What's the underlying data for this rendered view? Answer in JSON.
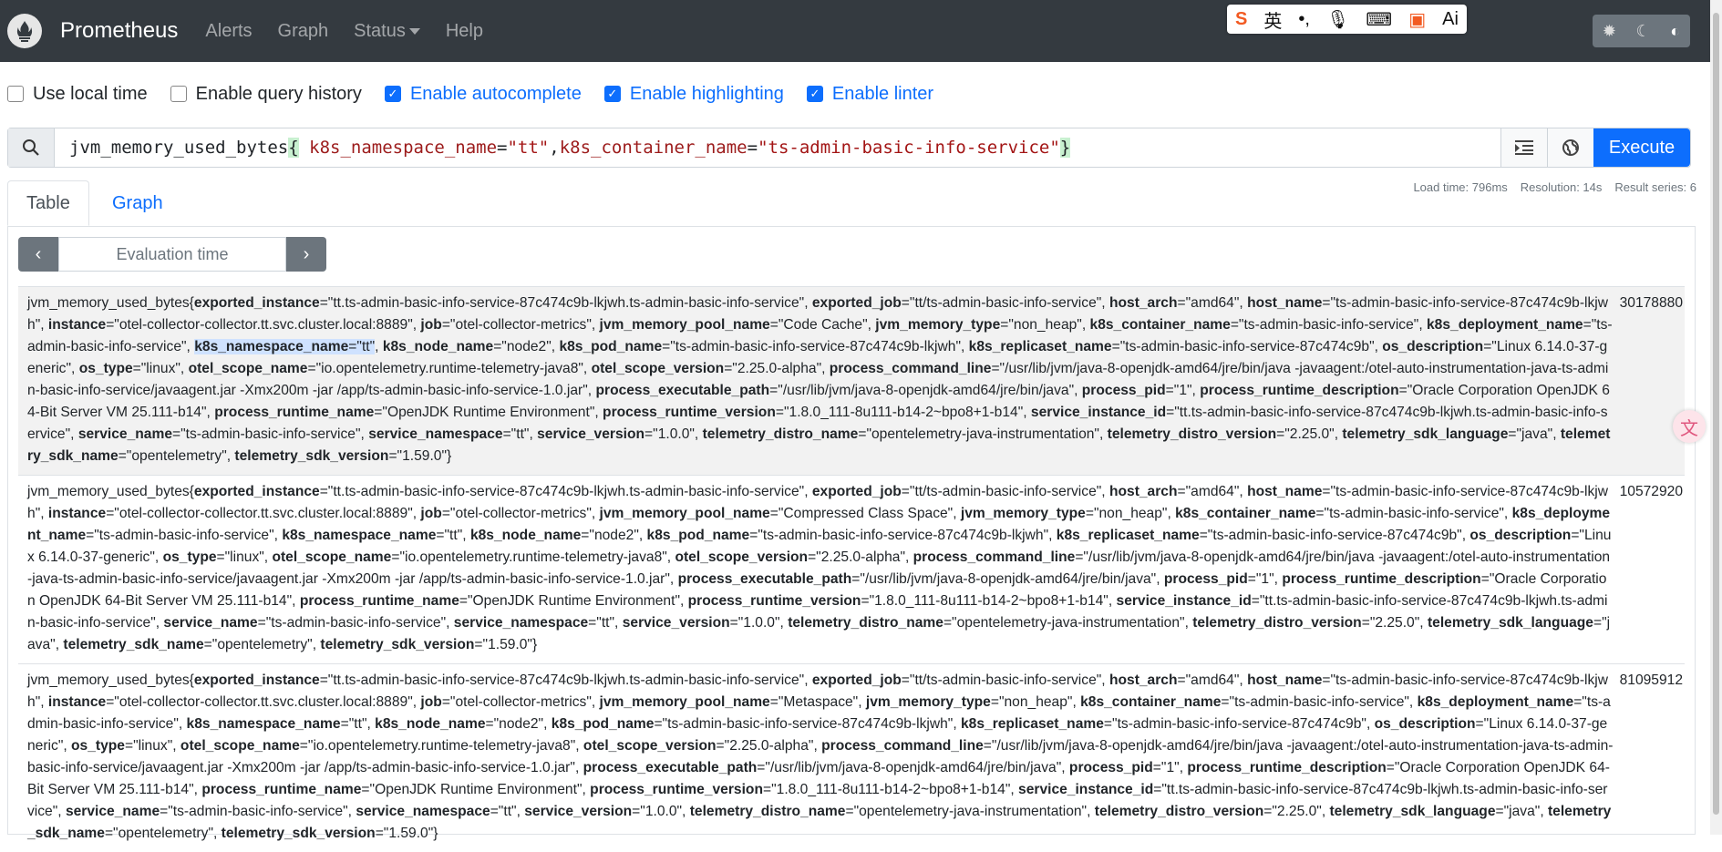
{
  "navbar": {
    "brand": "Prometheus",
    "items": [
      "Alerts",
      "Graph",
      "Status",
      "Help"
    ]
  },
  "ime_toolbar": {
    "lang_label": "英",
    "ai_label": "Ai"
  },
  "options": [
    {
      "label": "Use local time",
      "checked": false
    },
    {
      "label": "Enable query history",
      "checked": false
    },
    {
      "label": "Enable autocomplete",
      "checked": true
    },
    {
      "label": "Enable highlighting",
      "checked": true
    },
    {
      "label": "Enable linter",
      "checked": true
    }
  ],
  "query": {
    "metric": "jvm_memory_used_bytes",
    "open_brace": "{",
    "label1": "k8s_namespace_name",
    "value1": "\"tt\"",
    "label2": "k8s_container_name",
    "value2": "\"ts-admin-basic-info-service\"",
    "close_brace": "}",
    "execute_label": "Execute"
  },
  "stats": {
    "load_time": "Load time: 796ms",
    "resolution": "Resolution: 14s",
    "result_series": "Result series: 6"
  },
  "tabs": [
    "Table",
    "Graph"
  ],
  "evaluation": {
    "placeholder": "Evaluation time"
  },
  "results": [
    {
      "metric": "jvm_memory_used_bytes",
      "value": "30178880",
      "labels": [
        [
          "exported_instance",
          "tt.ts-admin-basic-info-service-87c474c9b-lkjwh.ts-admin-basic-info-service"
        ],
        [
          "exported_job",
          "tt/ts-admin-basic-info-service"
        ],
        [
          "host_arch",
          "amd64"
        ],
        [
          "host_name",
          "ts-admin-basic-info-service-87c474c9b-lkjwh"
        ],
        [
          "instance",
          "otel-collector-collector.tt.svc.cluster.local:8889"
        ],
        [
          "job",
          "otel-collector-metrics"
        ],
        [
          "jvm_memory_pool_name",
          "Code Cache"
        ],
        [
          "jvm_memory_type",
          "non_heap"
        ],
        [
          "k8s_container_name",
          "ts-admin-basic-info-service"
        ],
        [
          "k8s_deployment_name",
          "ts-admin-basic-info-service"
        ],
        [
          "k8s_namespace_name",
          "tt"
        ],
        [
          "k8s_node_name",
          "node2"
        ],
        [
          "k8s_pod_name",
          "ts-admin-basic-info-service-87c474c9b-lkjwh"
        ],
        [
          "k8s_replicaset_name",
          "ts-admin-basic-info-service-87c474c9b"
        ],
        [
          "os_description",
          "Linux 6.14.0-37-generic"
        ],
        [
          "os_type",
          "linux"
        ],
        [
          "otel_scope_name",
          "io.opentelemetry.runtime-telemetry-java8"
        ],
        [
          "otel_scope_version",
          "2.25.0-alpha"
        ],
        [
          "process_command_line",
          "/usr/lib/jvm/java-8-openjdk-amd64/jre/bin/java -javaagent:/otel-auto-instrumentation-java-ts-admin-basic-info-service/javaagent.jar -Xmx200m -jar /app/ts-admin-basic-info-service-1.0.jar"
        ],
        [
          "process_executable_path",
          "/usr/lib/jvm/java-8-openjdk-amd64/jre/bin/java"
        ],
        [
          "process_pid",
          "1"
        ],
        [
          "process_runtime_description",
          "Oracle Corporation OpenJDK 64-Bit Server VM 25.111-b14"
        ],
        [
          "process_runtime_name",
          "OpenJDK Runtime Environment"
        ],
        [
          "process_runtime_version",
          "1.8.0_111-8u111-b14-2~bpo8+1-b14"
        ],
        [
          "service_instance_id",
          "tt.ts-admin-basic-info-service-87c474c9b-lkjwh.ts-admin-basic-info-service"
        ],
        [
          "service_name",
          "ts-admin-basic-info-service"
        ],
        [
          "service_namespace",
          "tt"
        ],
        [
          "service_version",
          "1.0.0"
        ],
        [
          "telemetry_distro_name",
          "opentelemetry-java-instrumentation"
        ],
        [
          "telemetry_distro_version",
          "2.25.0"
        ],
        [
          "telemetry_sdk_language",
          "java"
        ],
        [
          "telemetry_sdk_name",
          "opentelemetry"
        ],
        [
          "telemetry_sdk_version",
          "1.59.0"
        ]
      ]
    },
    {
      "metric": "jvm_memory_used_bytes",
      "value": "10572920",
      "labels": [
        [
          "exported_instance",
          "tt.ts-admin-basic-info-service-87c474c9b-lkjwh.ts-admin-basic-info-service"
        ],
        [
          "exported_job",
          "tt/ts-admin-basic-info-service"
        ],
        [
          "host_arch",
          "amd64"
        ],
        [
          "host_name",
          "ts-admin-basic-info-service-87c474c9b-lkjwh"
        ],
        [
          "instance",
          "otel-collector-collector.tt.svc.cluster.local:8889"
        ],
        [
          "job",
          "otel-collector-metrics"
        ],
        [
          "jvm_memory_pool_name",
          "Compressed Class Space"
        ],
        [
          "jvm_memory_type",
          "non_heap"
        ],
        [
          "k8s_container_name",
          "ts-admin-basic-info-service"
        ],
        [
          "k8s_deployment_name",
          "ts-admin-basic-info-service"
        ],
        [
          "k8s_namespace_name",
          "tt"
        ],
        [
          "k8s_node_name",
          "node2"
        ],
        [
          "k8s_pod_name",
          "ts-admin-basic-info-service-87c474c9b-lkjwh"
        ],
        [
          "k8s_replicaset_name",
          "ts-admin-basic-info-service-87c474c9b"
        ],
        [
          "os_description",
          "Linux 6.14.0-37-generic"
        ],
        [
          "os_type",
          "linux"
        ],
        [
          "otel_scope_name",
          "io.opentelemetry.runtime-telemetry-java8"
        ],
        [
          "otel_scope_version",
          "2.25.0-alpha"
        ],
        [
          "process_command_line",
          "/usr/lib/jvm/java-8-openjdk-amd64/jre/bin/java -javaagent:/otel-auto-instrumentation-java-ts-admin-basic-info-service/javaagent.jar -Xmx200m -jar /app/ts-admin-basic-info-service-1.0.jar"
        ],
        [
          "process_executable_path",
          "/usr/lib/jvm/java-8-openjdk-amd64/jre/bin/java"
        ],
        [
          "process_pid",
          "1"
        ],
        [
          "process_runtime_description",
          "Oracle Corporation OpenJDK 64-Bit Server VM 25.111-b14"
        ],
        [
          "process_runtime_name",
          "OpenJDK Runtime Environment"
        ],
        [
          "process_runtime_version",
          "1.8.0_111-8u111-b14-2~bpo8+1-b14"
        ],
        [
          "service_instance_id",
          "tt.ts-admin-basic-info-service-87c474c9b-lkjwh.ts-admin-basic-info-service"
        ],
        [
          "service_name",
          "ts-admin-basic-info-service"
        ],
        [
          "service_namespace",
          "tt"
        ],
        [
          "service_version",
          "1.0.0"
        ],
        [
          "telemetry_distro_name",
          "opentelemetry-java-instrumentation"
        ],
        [
          "telemetry_distro_version",
          "2.25.0"
        ],
        [
          "telemetry_sdk_language",
          "java"
        ],
        [
          "telemetry_sdk_name",
          "opentelemetry"
        ],
        [
          "telemetry_sdk_version",
          "1.59.0"
        ]
      ]
    },
    {
      "metric": "jvm_memory_used_bytes",
      "value": "81095912",
      "labels": [
        [
          "exported_instance",
          "tt.ts-admin-basic-info-service-87c474c9b-lkjwh.ts-admin-basic-info-service"
        ],
        [
          "exported_job",
          "tt/ts-admin-basic-info-service"
        ],
        [
          "host_arch",
          "amd64"
        ],
        [
          "host_name",
          "ts-admin-basic-info-service-87c474c9b-lkjwh"
        ],
        [
          "instance",
          "otel-collector-collector.tt.svc.cluster.local:8889"
        ],
        [
          "job",
          "otel-collector-metrics"
        ],
        [
          "jvm_memory_pool_name",
          "Metaspace"
        ],
        [
          "jvm_memory_type",
          "non_heap"
        ],
        [
          "k8s_container_name",
          "ts-admin-basic-info-service"
        ],
        [
          "k8s_deployment_name",
          "ts-admin-basic-info-service"
        ],
        [
          "k8s_namespace_name",
          "tt"
        ],
        [
          "k8s_node_name",
          "node2"
        ],
        [
          "k8s_pod_name",
          "ts-admin-basic-info-service-87c474c9b-lkjwh"
        ],
        [
          "k8s_replicaset_name",
          "ts-admin-basic-info-service-87c474c9b"
        ],
        [
          "os_description",
          "Linux 6.14.0-37-generic"
        ],
        [
          "os_type",
          "linux"
        ],
        [
          "otel_scope_name",
          "io.opentelemetry.runtime-telemetry-java8"
        ],
        [
          "otel_scope_version",
          "2.25.0-alpha"
        ],
        [
          "process_command_line",
          "/usr/lib/jvm/java-8-openjdk-amd64/jre/bin/java -javaagent:/otel-auto-instrumentation-java-ts-admin-basic-info-service/javaagent.jar -Xmx200m -jar /app/ts-admin-basic-info-service-1.0.jar"
        ],
        [
          "process_executable_path",
          "/usr/lib/jvm/java-8-openjdk-amd64/jre/bin/java"
        ],
        [
          "process_pid",
          "1"
        ],
        [
          "process_runtime_description",
          "Oracle Corporation OpenJDK 64-Bit Server VM 25.111-b14"
        ],
        [
          "process_runtime_name",
          "OpenJDK Runtime Environment"
        ],
        [
          "process_runtime_version",
          "1.8.0_111-8u111-b14-2~bpo8+1-b14"
        ],
        [
          "service_instance_id",
          "tt.ts-admin-basic-info-service-87c474c9b-lkjwh.ts-admin-basic-info-service"
        ],
        [
          "service_name",
          "ts-admin-basic-info-service"
        ],
        [
          "service_namespace",
          "tt"
        ],
        [
          "service_version",
          "1.0.0"
        ],
        [
          "telemetry_distro_name",
          "opentelemetry-java-instrumentation"
        ],
        [
          "telemetry_distro_version",
          "2.25.0"
        ],
        [
          "telemetry_sdk_language",
          "java"
        ],
        [
          "telemetry_sdk_name",
          "opentelemetry"
        ],
        [
          "telemetry_sdk_version",
          "1.59.0"
        ]
      ]
    }
  ],
  "colors": {
    "navbar": "#343a40",
    "accent": "#0d6efd",
    "highlight": "#cfe2ff"
  }
}
